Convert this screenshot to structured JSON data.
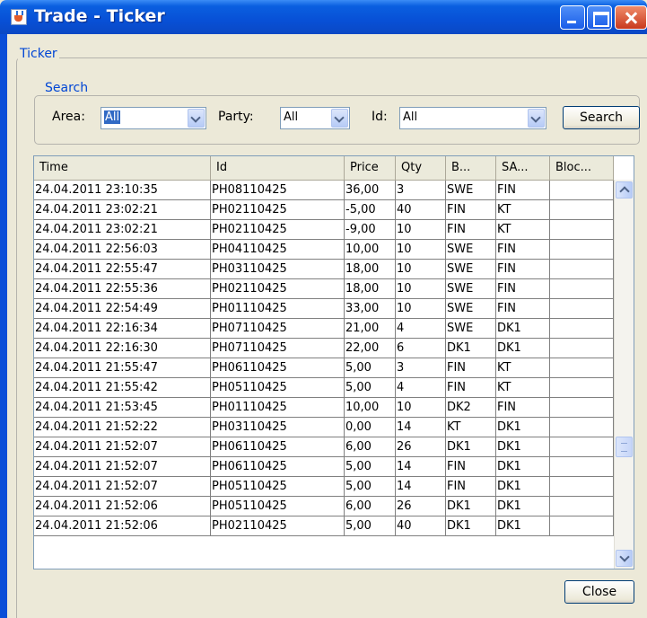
{
  "window": {
    "title": "Trade - Ticker"
  },
  "panel": {
    "legend": "Ticker"
  },
  "search": {
    "legend": "Search",
    "area_label": "Area:",
    "area_value": "All",
    "party_label": "Party:",
    "party_value": "All",
    "id_label": "Id:",
    "id_value": "All",
    "button": "Search"
  },
  "table": {
    "columns": [
      "Time",
      "Id",
      "Price",
      "Qty",
      "B...",
      "SA...",
      "Bloc..."
    ],
    "rows": [
      [
        "24.04.2011 23:10:35",
        "PH08110425",
        "36,00",
        "3",
        "SWE",
        "FIN",
        ""
      ],
      [
        "24.04.2011 23:02:21",
        "PH02110425",
        "-5,00",
        "40",
        "FIN",
        "KT",
        ""
      ],
      [
        "24.04.2011 23:02:21",
        "PH02110425",
        "-9,00",
        "10",
        "FIN",
        "KT",
        ""
      ],
      [
        "24.04.2011 22:56:03",
        "PH04110425",
        "10,00",
        "10",
        "SWE",
        "FIN",
        ""
      ],
      [
        "24.04.2011 22:55:47",
        "PH03110425",
        "18,00",
        "10",
        "SWE",
        "FIN",
        ""
      ],
      [
        "24.04.2011 22:55:36",
        "PH02110425",
        "18,00",
        "10",
        "SWE",
        "FIN",
        ""
      ],
      [
        "24.04.2011 22:54:49",
        "PH01110425",
        "33,00",
        "10",
        "SWE",
        "FIN",
        ""
      ],
      [
        "24.04.2011 22:16:34",
        "PH07110425",
        "21,00",
        "4",
        "SWE",
        "DK1",
        ""
      ],
      [
        "24.04.2011 22:16:30",
        "PH07110425",
        "22,00",
        "6",
        "DK1",
        "DK1",
        ""
      ],
      [
        "24.04.2011 21:55:47",
        "PH06110425",
        "5,00",
        "3",
        "FIN",
        "KT",
        ""
      ],
      [
        "24.04.2011 21:55:42",
        "PH05110425",
        "5,00",
        "4",
        "FIN",
        "KT",
        ""
      ],
      [
        "24.04.2011 21:53:45",
        "PH01110425",
        "10,00",
        "10",
        "DK2",
        "FIN",
        ""
      ],
      [
        "24.04.2011 21:52:22",
        "PH03110425",
        "0,00",
        "14",
        "KT",
        "DK1",
        ""
      ],
      [
        "24.04.2011 21:52:07",
        "PH06110425",
        "6,00",
        "26",
        "DK1",
        "DK1",
        ""
      ],
      [
        "24.04.2011 21:52:07",
        "PH06110425",
        "5,00",
        "14",
        "FIN",
        "DK1",
        ""
      ],
      [
        "24.04.2011 21:52:07",
        "PH05110425",
        "5,00",
        "14",
        "FIN",
        "DK1",
        ""
      ],
      [
        "24.04.2011 21:52:06",
        "PH05110425",
        "6,00",
        "26",
        "DK1",
        "DK1",
        ""
      ],
      [
        "24.04.2011 21:52:06",
        "PH02110425",
        "5,00",
        "40",
        "DK1",
        "DK1",
        ""
      ]
    ]
  },
  "footer": {
    "close_button": "Close"
  }
}
